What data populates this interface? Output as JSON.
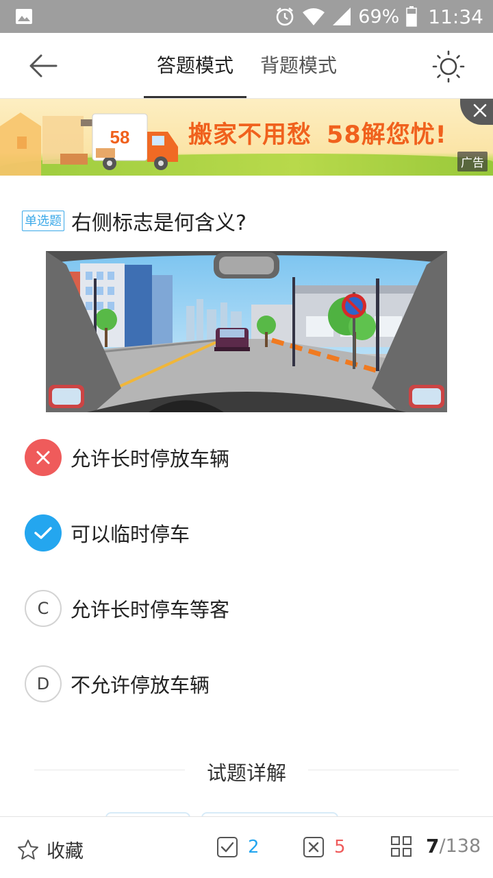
{
  "status_bar": {
    "battery_percent": "69%",
    "time": "11:34",
    "icons": [
      "gallery-icon",
      "alarm-icon",
      "wifi-icon",
      "signal-icon",
      "battery-icon"
    ]
  },
  "nav": {
    "tabs": [
      {
        "label": "答题模式",
        "active": true
      },
      {
        "label": "背题模式",
        "active": false
      }
    ],
    "back_icon": "arrow-left-icon",
    "theme_icon": "sun-icon"
  },
  "ad": {
    "headline_part1": "搬家不用愁",
    "headline_part2": "58解您忧!",
    "truck_logo": "58",
    "badge": "广告"
  },
  "question": {
    "type_label": "单选题",
    "text": "右侧标志是何含义?"
  },
  "options": [
    {
      "marker": "",
      "state": "wrong",
      "text": "允许长时停放车辆"
    },
    {
      "marker": "",
      "state": "correct",
      "text": "可以临时停车"
    },
    {
      "marker": "C",
      "state": "plain",
      "text": "允许长时停车等客"
    },
    {
      "marker": "D",
      "state": "plain",
      "text": "不允许停放车辆"
    }
  ],
  "detail": {
    "title": "试题详解"
  },
  "bottom_bar": {
    "favorite_label": "收藏",
    "correct_count": "2",
    "wrong_count": "5",
    "current_index": "7",
    "total": "/138"
  },
  "colors": {
    "accent_blue": "#24a6ef",
    "error_red": "#ef5b5b",
    "ad_orange": "#f0611d",
    "status_bar_gray": "#9e9e9e"
  }
}
